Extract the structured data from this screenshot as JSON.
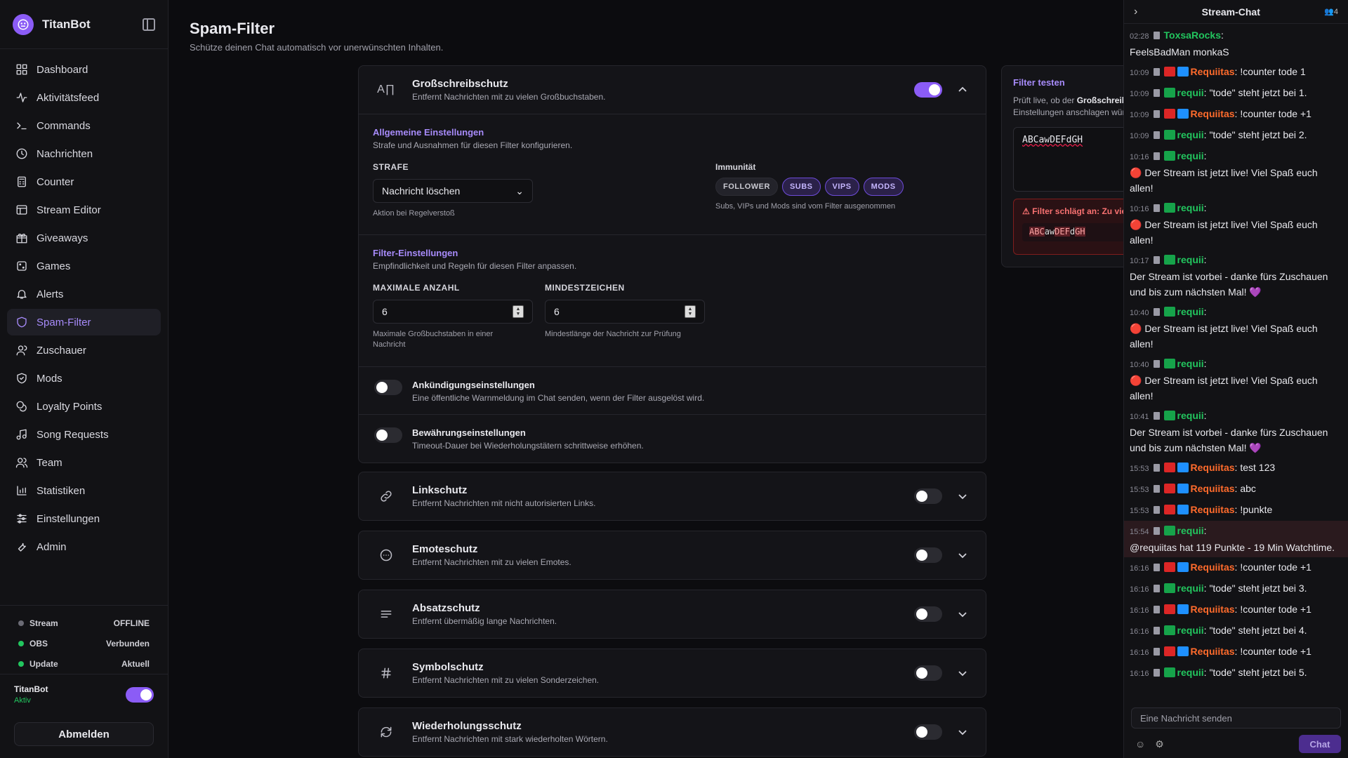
{
  "app": {
    "name": "TitanBot"
  },
  "sidebar": {
    "items": [
      {
        "label": "Dashboard",
        "icon": "dashboard-icon"
      },
      {
        "label": "Aktivitätsfeed",
        "icon": "activity-icon"
      },
      {
        "label": "Commands",
        "icon": "terminal-icon"
      },
      {
        "label": "Nachrichten",
        "icon": "clock-icon"
      },
      {
        "label": "Counter",
        "icon": "calculator-icon"
      },
      {
        "label": "Stream Editor",
        "icon": "layout-icon"
      },
      {
        "label": "Giveaways",
        "icon": "gift-icon"
      },
      {
        "label": "Games",
        "icon": "dice-icon"
      },
      {
        "label": "Alerts",
        "icon": "bell-icon"
      },
      {
        "label": "Spam-Filter",
        "icon": "shield-icon",
        "active": true
      },
      {
        "label": "Zuschauer",
        "icon": "users-icon"
      },
      {
        "label": "Mods",
        "icon": "shield-check-icon"
      },
      {
        "label": "Loyalty Points",
        "icon": "coins-icon"
      },
      {
        "label": "Song Requests",
        "icon": "music-icon"
      },
      {
        "label": "Team",
        "icon": "team-icon"
      },
      {
        "label": "Statistiken",
        "icon": "bar-chart-icon"
      },
      {
        "label": "Einstellungen",
        "icon": "sliders-icon"
      },
      {
        "label": "Admin",
        "icon": "wrench-icon"
      }
    ],
    "status": [
      {
        "label": "Stream",
        "value": "OFFLINE",
        "color": "#6b6b75"
      },
      {
        "label": "OBS",
        "value": "Verbunden",
        "color": "#22c55e"
      },
      {
        "label": "Update",
        "value": "Aktuell",
        "color": "#22c55e"
      }
    ],
    "bot": {
      "name": "TitanBot",
      "state": "Aktiv",
      "enabled": true
    },
    "logout_label": "Abmelden"
  },
  "page": {
    "title": "Spam-Filter",
    "subtitle": "Schütze deinen Chat automatisch vor unerwünschten Inhalten."
  },
  "caps": {
    "title": "Großschreibschutz",
    "desc": "Entfernt Nachrichten mit zu vielen Großbuchstaben.",
    "enabled": true,
    "general": {
      "title": "Allgemeine Einstellungen",
      "sub": "Strafe und Ausnahmen für diesen Filter konfigurieren.",
      "penalty_label": "STRAFE",
      "penalty_value": "Nachricht löschen",
      "penalty_hint": "Aktion bei Regelverstoß",
      "immunity_label": "Immunität",
      "immunity": [
        {
          "label": "FOLLOWER",
          "active": false
        },
        {
          "label": "SUBS",
          "active": true
        },
        {
          "label": "VIPS",
          "active": true
        },
        {
          "label": "MODS",
          "active": true
        }
      ],
      "immunity_hint": "Subs, VIPs und Mods sind vom Filter ausgenommen"
    },
    "filter": {
      "title": "Filter-Einstellungen",
      "sub": "Empfindlichkeit und Regeln für diesen Filter anpassen.",
      "max_label": "MAXIMALE ANZAHL",
      "max_value": "6",
      "max_hint": "Maximale Großbuchstaben in einer Nachricht",
      "min_label": "MINDESTZEICHEN",
      "min_value": "6",
      "min_hint": "Mindestlänge der Nachricht zur Prüfung"
    },
    "announce": {
      "title": "Ankündigungseinstellungen",
      "desc": "Eine öffentliche Warnmeldung im Chat senden, wenn der Filter ausgelöst wird."
    },
    "probation": {
      "title": "Bewährungseinstellungen",
      "desc": "Timeout-Dauer bei Wiederholungstätern schrittweise erhöhen."
    }
  },
  "filters": [
    {
      "title": "Linkschutz",
      "desc": "Entfernt Nachrichten mit nicht autorisierten Links.",
      "icon": "link-icon"
    },
    {
      "title": "Emoteschutz",
      "desc": "Entfernt Nachrichten mit zu vielen Emotes.",
      "icon": "emote-icon"
    },
    {
      "title": "Absatzschutz",
      "desc": "Entfernt übermäßig lange Nachrichten.",
      "icon": "paragraph-icon"
    },
    {
      "title": "Symbolschutz",
      "desc": "Entfernt Nachrichten mit zu vielen Sonderzeichen.",
      "icon": "hash-icon"
    },
    {
      "title": "Wiederholungsschutz",
      "desc": "Entfernt Nachrichten mit stark wiederholten Wörtern.",
      "icon": "repeat-icon"
    }
  ],
  "test": {
    "title": "Filter testen",
    "desc_pre": "Prüft live, ob der ",
    "desc_bold": "Großschreibschutz",
    "desc_post": " mit den aktuellen Einstellungen anschlagen würde. Immunität wird ignoriert.",
    "input": "ABCawDEFdGH",
    "alert": "Filter schlägt an: Zu viele Großbuchstaben",
    "result_parts": [
      {
        "t": "ABC",
        "hl": true
      },
      {
        "t": "aw",
        "hl": false
      },
      {
        "t": "DEF",
        "hl": true
      },
      {
        "t": "d",
        "hl": false
      },
      {
        "t": "GH",
        "hl": true
      }
    ]
  },
  "chat": {
    "title": "Stream-Chat",
    "viewers": "4",
    "input_placeholder": "Eine Nachricht senden",
    "send_label": "Chat",
    "messages": [
      {
        "time": "02:28",
        "user": "ToxsaRocks",
        "color": "g",
        "badges": [],
        "text": "FeelsBadMan monkaS",
        "block": true
      },
      {
        "time": "10:09",
        "user": "Requiitas",
        "color": "r",
        "badges": [
          "yt",
          "cr"
        ],
        "text": "!counter tode 1"
      },
      {
        "time": "10:09",
        "user": "requii",
        "color": "g",
        "badges": [
          "ck"
        ],
        "text": "\"tode\" steht jetzt bei 1."
      },
      {
        "time": "10:09",
        "user": "Requiitas",
        "color": "r",
        "badges": [
          "yt",
          "cr"
        ],
        "text": "!counter tode +1"
      },
      {
        "time": "10:09",
        "user": "requii",
        "color": "g",
        "badges": [
          "ck"
        ],
        "text": "\"tode\" steht jetzt bei 2."
      },
      {
        "time": "10:16",
        "user": "requii",
        "color": "g",
        "badges": [
          "ck"
        ],
        "text": "🔴 Der Stream ist jetzt live! Viel Spaß euch allen!",
        "block": true
      },
      {
        "time": "10:16",
        "user": "requii",
        "color": "g",
        "badges": [
          "ck"
        ],
        "text": "🔴 Der Stream ist jetzt live! Viel Spaß euch allen!",
        "block": true
      },
      {
        "time": "10:17",
        "user": "requii",
        "color": "g",
        "badges": [
          "ck"
        ],
        "text": "Der Stream ist vorbei - danke fürs Zuschauen und bis zum nächsten Mal! 💜",
        "block": true
      },
      {
        "time": "10:40",
        "user": "requii",
        "color": "g",
        "badges": [
          "ck"
        ],
        "text": "🔴 Der Stream ist jetzt live! Viel Spaß euch allen!",
        "block": true
      },
      {
        "time": "10:40",
        "user": "requii",
        "color": "g",
        "badges": [
          "ck"
        ],
        "text": "🔴 Der Stream ist jetzt live! Viel Spaß euch allen!",
        "block": true
      },
      {
        "time": "10:41",
        "user": "requii",
        "color": "g",
        "badges": [
          "ck"
        ],
        "text": "Der Stream ist vorbei - danke fürs Zuschauen und bis zum nächsten Mal! 💜",
        "block": true
      },
      {
        "time": "15:53",
        "user": "Requiitas",
        "color": "r",
        "badges": [
          "yt",
          "cr"
        ],
        "text": "test 123"
      },
      {
        "time": "15:53",
        "user": "Requiitas",
        "color": "r",
        "badges": [
          "yt",
          "cr"
        ],
        "text": "abc"
      },
      {
        "time": "15:53",
        "user": "Requiitas",
        "color": "r",
        "badges": [
          "yt",
          "cr"
        ],
        "text": "!punkte"
      },
      {
        "time": "15:54",
        "user": "requii",
        "color": "g",
        "badges": [
          "ck"
        ],
        "text": "@requiitas hat 119 Punkte - 19 Min Watchtime.",
        "block": true,
        "highlight": true
      },
      {
        "time": "16:16",
        "user": "Requiitas",
        "color": "r",
        "badges": [
          "yt",
          "cr"
        ],
        "text": "!counter tode +1"
      },
      {
        "time": "16:16",
        "user": "requii",
        "color": "g",
        "badges": [
          "ck"
        ],
        "text": "\"tode\" steht jetzt bei 3."
      },
      {
        "time": "16:16",
        "user": "Requiitas",
        "color": "r",
        "badges": [
          "yt",
          "cr"
        ],
        "text": "!counter tode +1"
      },
      {
        "time": "16:16",
        "user": "requii",
        "color": "g",
        "badges": [
          "ck"
        ],
        "text": "\"tode\" steht jetzt bei 4."
      },
      {
        "time": "16:16",
        "user": "Requiitas",
        "color": "r",
        "badges": [
          "yt",
          "cr"
        ],
        "text": "!counter tode +1"
      },
      {
        "time": "16:16",
        "user": "requii",
        "color": "g",
        "badges": [
          "ck"
        ],
        "text": "\"tode\" steht jetzt bei 5."
      }
    ]
  }
}
